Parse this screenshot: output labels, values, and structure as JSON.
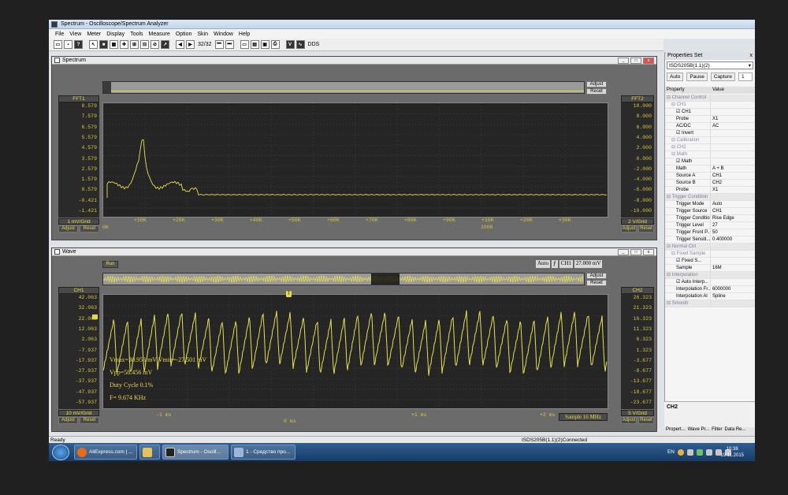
{
  "window": {
    "title": "Spectrum - Oscilloscope/Spectrum Analyzer"
  },
  "menu": [
    "File",
    "View",
    "Meter",
    "Display",
    "Tools",
    "Measure",
    "Option",
    "Skin",
    "Window",
    "Help"
  ],
  "toolbar": {
    "page_counter": "32/32",
    "dds_label": "DDS",
    "v_label": "V"
  },
  "spectrum": {
    "title": "Spectrum",
    "left_channel": "FFT1",
    "right_channel": "FFT2",
    "left_scale": "1 mV/Grid",
    "right_scale": "2 V/Grid",
    "adjust": "Adjust",
    "reset": "Reset",
    "left_ticks": [
      "8.579",
      "7.579",
      "6.579",
      "5.579",
      "4.579",
      "3.579",
      "2.579",
      "1.579",
      "0.579",
      "-0.421",
      "-1.421"
    ],
    "right_ticks": [
      "10.000",
      "8.000",
      "6.000",
      "4.000",
      "2.000",
      "0.000",
      "-2.000",
      "-4.000",
      "-6.000",
      "-8.000",
      "-10.000"
    ],
    "x_ticks_top": [
      "+10K",
      "+20K",
      "+30K",
      "+40K",
      "+50K",
      "+60K",
      "+70K",
      "+80K",
      "+90K",
      "+10K",
      "+20K",
      "+30K"
    ],
    "x_ticks_bottom": [
      "0K",
      "100K"
    ]
  },
  "wave": {
    "title": "Wave",
    "run_label": "Run",
    "trigger_mode": "Auto",
    "trigger_channel": "CH1",
    "trigger_level": "27.000 mV",
    "left_channel": "CH1",
    "right_channel": "CH2",
    "left_scale": "10 mV/Grid",
    "right_scale": "5 V/Grid",
    "adjust": "Adjust",
    "reset": "Reset",
    "left_ticks": [
      "42.063",
      "32.063",
      "22.063",
      "12.063",
      "2.063",
      "-7.937",
      "-17.937",
      "-27.937",
      "-37.937",
      "-47.937",
      "-57.937"
    ],
    "right_ticks": [
      "26.323",
      "21.323",
      "16.323",
      "11.323",
      "6.323",
      "1.323",
      "-3.677",
      "-8.677",
      "-13.677",
      "-18.677",
      "-23.677"
    ],
    "x_ticks": [
      "-1 ms",
      "0 ms",
      "+1 ms",
      "+2 ms"
    ],
    "measurements": {
      "vmax_vmin": "Vmax=30.953 mV  Vmin=-27.501 mV",
      "vpp": "Vpp=58.456 mV",
      "duty": "Duty Cycle 0.1%",
      "freq": "F= 9.674 KHz"
    },
    "sample_label": "Sample 16 MHz",
    "trigger_marker": "T"
  },
  "properties": {
    "title": "Properties Set",
    "device": "ISDS205B(1.1)(2)",
    "buttons": [
      "Auto",
      "Pause",
      "Capture"
    ],
    "capture_count": "1",
    "col_property": "Property",
    "col_value": "Value",
    "rows": [
      {
        "k": "Channel Control",
        "v": "",
        "t": "cat"
      },
      {
        "k": "CH1",
        "v": "",
        "t": "sub"
      },
      {
        "k": "CH1",
        "v": "",
        "t": "chk"
      },
      {
        "k": "Probe",
        "v": "X1",
        "t": ""
      },
      {
        "k": "AC/DC",
        "v": "AC",
        "t": ""
      },
      {
        "k": "Invert",
        "v": "",
        "t": "chk"
      },
      {
        "k": "Calibration",
        "v": "",
        "t": "sub"
      },
      {
        "k": "CH2",
        "v": "",
        "t": "sub"
      },
      {
        "k": "Math",
        "v": "",
        "t": "sub"
      },
      {
        "k": "Math",
        "v": "",
        "t": "chk"
      },
      {
        "k": "Math",
        "v": "A + B",
        "t": ""
      },
      {
        "k": "Source A",
        "v": "CH1",
        "t": ""
      },
      {
        "k": "Source B",
        "v": "CH2",
        "t": ""
      },
      {
        "k": "Probe",
        "v": "X1",
        "t": ""
      },
      {
        "k": "Trigger Condition",
        "v": "",
        "t": "cat"
      },
      {
        "k": "Trigger Mode",
        "v": "Auto",
        "t": ""
      },
      {
        "k": "Trigger Source",
        "v": "CH1",
        "t": ""
      },
      {
        "k": "Trigger Condition",
        "v": "Rise Edge",
        "t": ""
      },
      {
        "k": "Trigger Level",
        "v": "27",
        "t": ""
      },
      {
        "k": "Trigger Front P...",
        "v": "50",
        "t": ""
      },
      {
        "k": "Trigger Sensiti...",
        "v": "0.400000",
        "t": ""
      },
      {
        "k": "Normal Ctrl",
        "v": "",
        "t": "cat"
      },
      {
        "k": "Fixed Sample",
        "v": "",
        "t": "sub"
      },
      {
        "k": "Fixed S...",
        "v": "",
        "t": "chk"
      },
      {
        "k": "Sample",
        "v": "16M",
        "t": ""
      },
      {
        "k": "Interpolation",
        "v": "",
        "t": "cat"
      },
      {
        "k": "Auto Interp...",
        "v": "",
        "t": "chk"
      },
      {
        "k": "Interpolation Fr...",
        "v": "6000000",
        "t": ""
      },
      {
        "k": "Interpolation Al",
        "v": "Spline",
        "t": ""
      },
      {
        "k": "Smooth",
        "v": "",
        "t": "cat"
      }
    ],
    "description": "CH2",
    "tabs": [
      "Propert...",
      "Wave Pr...",
      "Filter",
      "Data Re..."
    ]
  },
  "status": {
    "left": "Ready",
    "right": "ISDS205B(1.1)(2)Connected"
  },
  "taskbar": {
    "tasks": [
      "AliExpress.com | ...",
      "",
      "Spectrum - Oscill...",
      "1 - Средство про..."
    ],
    "lang": "EN",
    "time": "10:38",
    "date": "19.11.2015"
  },
  "colors": {
    "trace": "#e8e04a",
    "plot_bg": "#252525",
    "grid": "#3c3c3c",
    "label": "#d6c23c"
  }
}
